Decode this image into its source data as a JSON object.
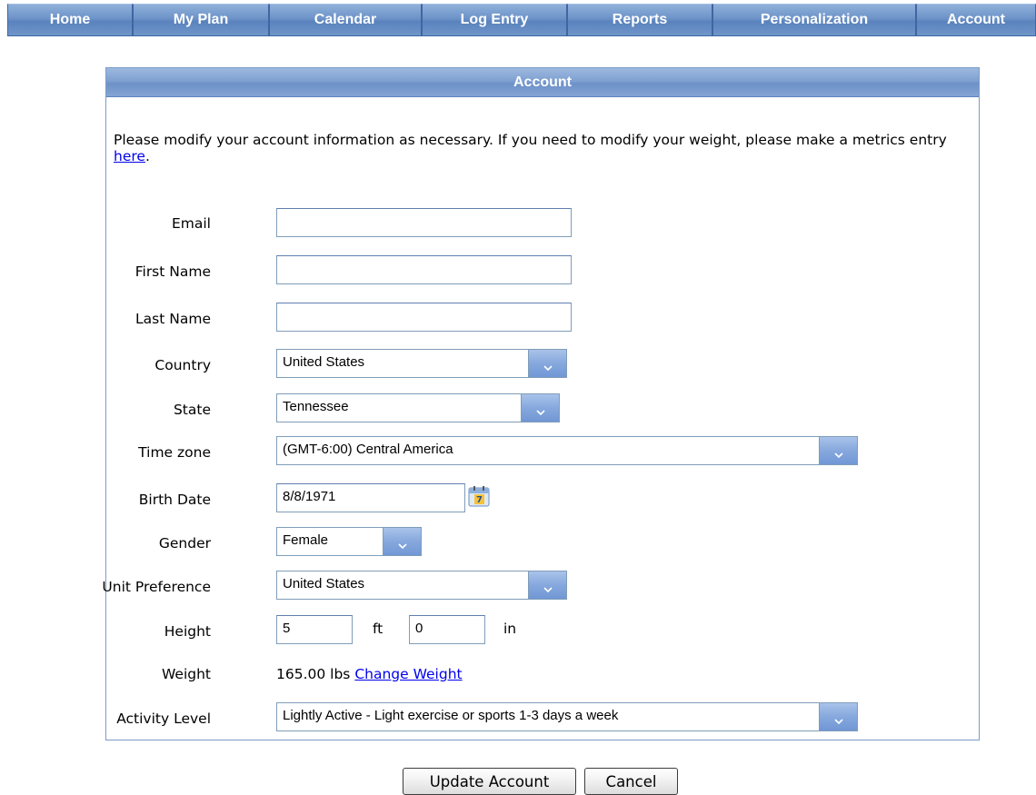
{
  "nav": {
    "tabs": [
      "Home",
      "My Plan",
      "Calendar",
      "Log Entry",
      "Reports",
      "Personalization",
      "Account"
    ]
  },
  "panel": {
    "title": "Account",
    "intro_text": "Please modify your account information as necessary. If you need to modify your weight, please make a metrics entry ",
    "intro_link": "here",
    "intro_end": "."
  },
  "form": {
    "email": {
      "label": "Email",
      "value": ""
    },
    "first_name": {
      "label": "First Name",
      "value": ""
    },
    "last_name": {
      "label": "Last Name",
      "value": ""
    },
    "country": {
      "label": "Country",
      "value": "United States"
    },
    "state": {
      "label": "State",
      "value": "Tennessee"
    },
    "time_zone": {
      "label": "Time zone",
      "value": "(GMT-6:00) Central America"
    },
    "birth_date": {
      "label": "Birth Date",
      "value": "8/8/1971",
      "calendar_icon_day": "7"
    },
    "gender": {
      "label": "Gender",
      "value": "Female"
    },
    "unit_preference": {
      "label": "Unit Preference",
      "value": "United States"
    },
    "height": {
      "label": "Height",
      "feet": "5",
      "feet_unit": "ft",
      "inches": "0",
      "inches_unit": "in"
    },
    "weight": {
      "label": "Weight",
      "value": "165.00 lbs",
      "link": "Change Weight"
    },
    "activity_level": {
      "label": "Activity Level",
      "value": "Lightly Active - Light exercise or sports 1-3 days a week"
    }
  },
  "buttons": {
    "update": "Update Account",
    "cancel": "Cancel"
  },
  "icons": {
    "dropdown": "chevron-down-icon",
    "calendar": "calendar-icon"
  },
  "colors": {
    "nav_blue": "#6d93c8",
    "link": "#0000ee",
    "border": "#7f9db9"
  }
}
